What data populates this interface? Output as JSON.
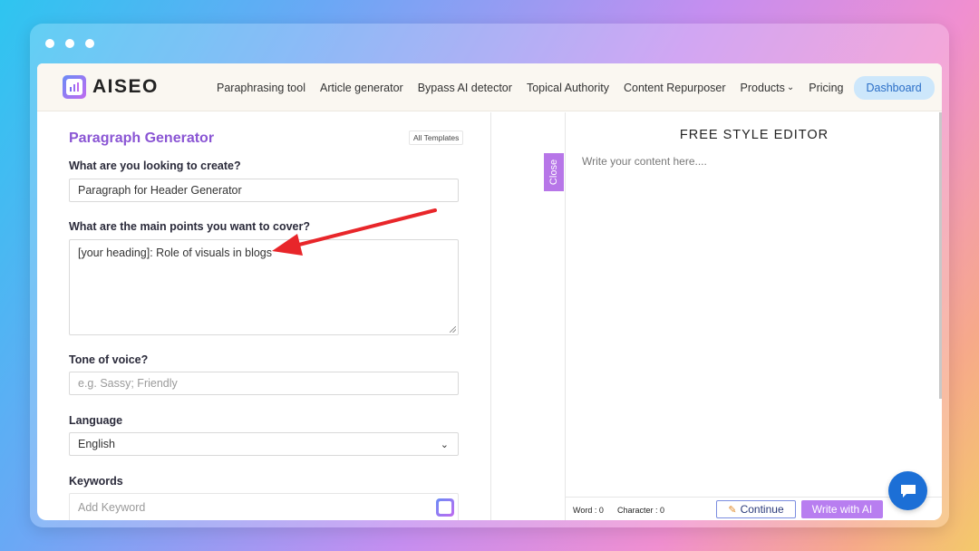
{
  "nav": {
    "logo": "AISEO",
    "links": [
      "Paraphrasing tool",
      "Article generator",
      "Bypass AI detector",
      "Topical Authority",
      "Content Repurposer",
      "Products",
      "Pricing"
    ],
    "dashboard": "Dashboard"
  },
  "form": {
    "title": "Paragraph Generator",
    "all_templates": "All Templates",
    "q1_label": "What are you looking to create?",
    "q1_value": "Paragraph for Header Generator",
    "q2_label": "What are the main points you want to cover?",
    "q2_value": "[your heading]: Role of visuals in blogs",
    "tone_label": "Tone of voice?",
    "tone_placeholder": "e.g. Sassy; Friendly",
    "language_label": "Language",
    "language_value": "English",
    "keywords_label": "Keywords",
    "keywords_placeholder": "Add Keyword"
  },
  "editor": {
    "close": "Close",
    "title": "FREE STYLE EDITOR",
    "placeholder": "Write your content here....",
    "word_count": "Word : 0",
    "char_count": "Character : 0",
    "continue": "Continue",
    "write_ai": "Write with AI"
  },
  "colors": {
    "accent": "#8a55d4",
    "annotation_arrow": "#e8262a",
    "chat": "#1c6fd6"
  }
}
